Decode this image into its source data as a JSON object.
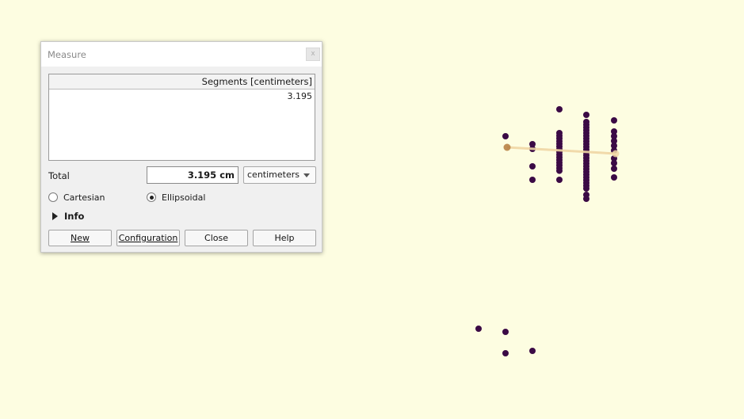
{
  "window": {
    "title": "Measure",
    "close_glyph": "x"
  },
  "segments": {
    "header": "Segments [centimeters]",
    "values": [
      "3.195"
    ]
  },
  "total": {
    "label": "Total",
    "value": "3.195 cm"
  },
  "units_select": {
    "selected": "centimeters"
  },
  "mode": {
    "cartesian_label": "Cartesian",
    "ellipsoidal_label": "Ellipsoidal",
    "selected": "Ellipsoidal"
  },
  "info": {
    "label": "Info",
    "expanded": false
  },
  "buttons": {
    "new": "New",
    "configuration": "Configuration",
    "close": "Close",
    "help": "Help"
  },
  "map": {
    "background_color": "#fdfde1",
    "point_color": "#3b0a45",
    "measure_line_color": "#f0d6a4",
    "measure_vertex_color": "#b47a3c"
  }
}
